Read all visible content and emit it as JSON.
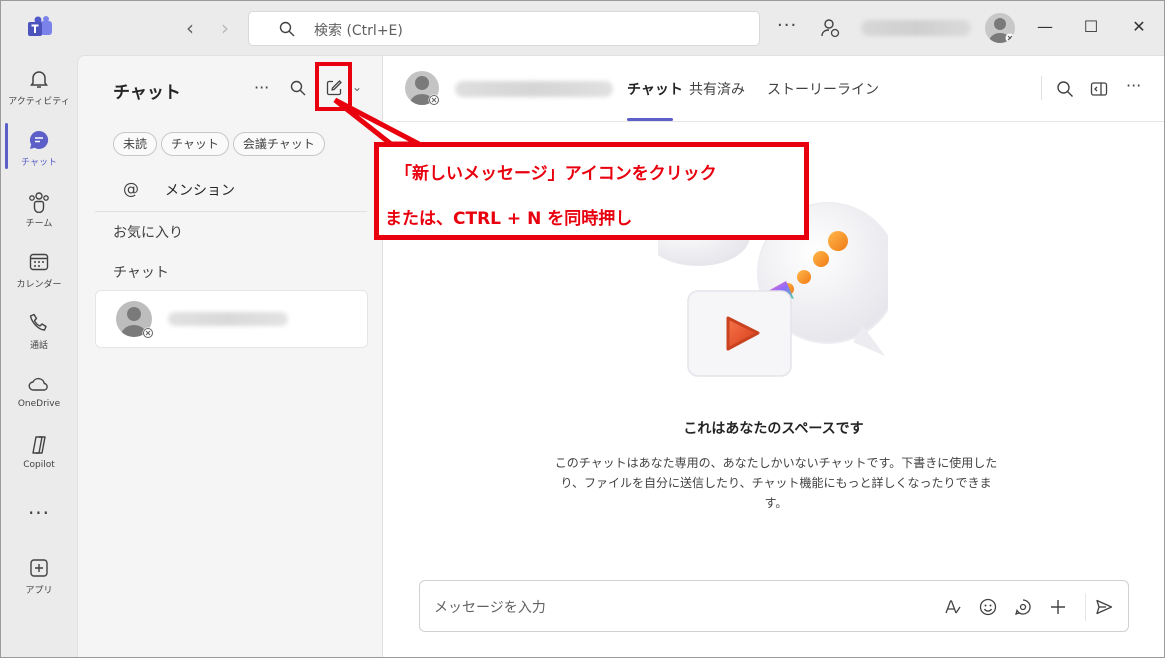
{
  "colors": {
    "accent": "#5b5fc7",
    "annotation": "#e8000e",
    "background": "#ebebeb"
  },
  "titlebar": {
    "app_icon": "teams-logo-icon",
    "search_placeholder": "検索 (Ctrl+E)",
    "more_label": "···"
  },
  "rail": {
    "items": [
      {
        "label": "アクティビティ",
        "icon": "bell-icon"
      },
      {
        "label": "チャット",
        "icon": "chat-icon"
      },
      {
        "label": "チーム",
        "icon": "teams-icon"
      },
      {
        "label": "カレンダー",
        "icon": "calendar-icon"
      },
      {
        "label": "通話",
        "icon": "phone-icon"
      },
      {
        "label": "OneDrive",
        "icon": "cloud-icon"
      },
      {
        "label": "Copilot",
        "icon": "copilot-icon"
      },
      {
        "label": "アプリ",
        "icon": "add-app-icon"
      }
    ],
    "more_label": "···"
  },
  "chatpane": {
    "title": "チャット",
    "more_label": "···",
    "filters": [
      "未読",
      "チャット",
      "会議チャット"
    ],
    "mention_symbol": "@",
    "mention_label": "メンション",
    "favorites_label": "お気に入り",
    "chats_label": "チャット"
  },
  "main": {
    "tabs": [
      "チャット",
      "共有済み",
      "ストーリーライン"
    ],
    "more_label": "···",
    "empty_title": "これはあなたのスペースです",
    "empty_desc": "このチャットはあなた専用の、あなたしかいないチャットです。下書きに使用したり、ファイルを自分に送信したり、チャット機能にもっと詳しくなったりできます。",
    "composer_placeholder": "メッセージを入力"
  },
  "callout": {
    "line1": "「新しいメッセージ」アイコンをクリック",
    "line2": "または、CTRL + N を同時押し"
  }
}
